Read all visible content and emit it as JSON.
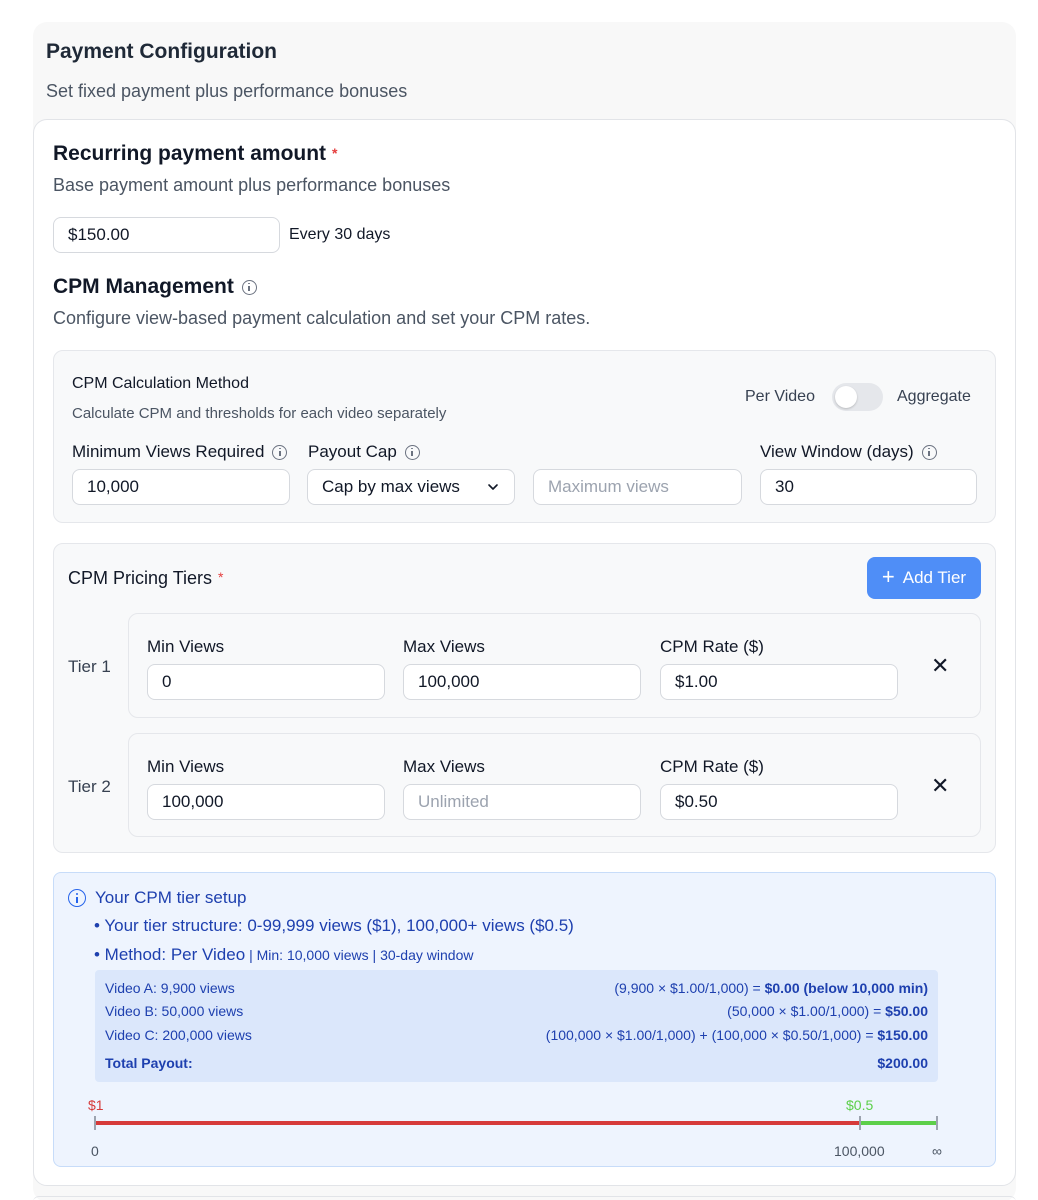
{
  "header": {
    "title": "Payment Configuration",
    "subtitle": "Set fixed payment plus performance bonuses"
  },
  "recurring": {
    "title": "Recurring payment amount",
    "required_mark": "*",
    "description": "Base payment amount plus performance bonuses",
    "amount_value": "$150.00",
    "frequency": "Every 30 days"
  },
  "cpm_management": {
    "title": "CPM Management",
    "description": "Configure view-based payment calculation and set your CPM rates.",
    "method": {
      "title": "CPM Calculation Method",
      "description": "Calculate CPM and thresholds for each video separately",
      "toggle_left": "Per Video",
      "toggle_right": "Aggregate",
      "toggle_on": false
    },
    "min_views": {
      "label": "Minimum Views Required",
      "value": "10,000"
    },
    "payout_cap": {
      "label": "Payout Cap",
      "selected": "Cap by max views",
      "max_placeholder": "Maximum views"
    },
    "view_window": {
      "label": "View Window (days)",
      "value": "30"
    }
  },
  "tiers": {
    "title": "CPM Pricing Tiers",
    "required_mark": "*",
    "add_label": "Add Tier",
    "items": [
      {
        "name": "Tier 1",
        "min_label": "Min Views",
        "min_value": "0",
        "max_label": "Max Views",
        "max_value": "100,000",
        "max_placeholder": "",
        "rate_label": "CPM Rate ($)",
        "rate_value": "$1.00"
      },
      {
        "name": "Tier 2",
        "min_label": "Min Views",
        "min_value": "100,000",
        "max_label": "Max Views",
        "max_value": "",
        "max_placeholder": "Unlimited",
        "rate_label": "CPM Rate ($)",
        "rate_value": "$0.50"
      }
    ]
  },
  "setup": {
    "title": "Your CPM tier setup",
    "structure_line": "• Your tier structure: 0-99,999 views ($1), 100,000+ views ($0.5)",
    "method_line": "• Method: Per Video",
    "method_detail": " | Min: 10,000 views | 30-day window",
    "examples": [
      {
        "video": "Video A: 9,900 views",
        "formula": "(9,900 × $1.00/1,000) = ",
        "result": "$0.00 (below 10,000 min)"
      },
      {
        "video": "Video B: 50,000 views",
        "formula": "(50,000 × $1.00/1,000) = ",
        "result": "$50.00"
      },
      {
        "video": "Video C: 200,000 views",
        "formula": "(100,000 × $1.00/1,000) + (100,000 × $0.50/1,000) = ",
        "result": "$150.00"
      }
    ],
    "total_label": "Total Payout:",
    "total_value": "$200.00",
    "scale": {
      "rate_1": "$1",
      "rate_2": "$0.5",
      "start": "0",
      "breakpoint": "100,000",
      "end": "∞",
      "color_1": "#d63a3a",
      "color_2": "#5ccf4a"
    }
  },
  "colors": {
    "accent": "#4f8ef7",
    "required": "#e53e3e",
    "info_text": "#1e40af"
  }
}
